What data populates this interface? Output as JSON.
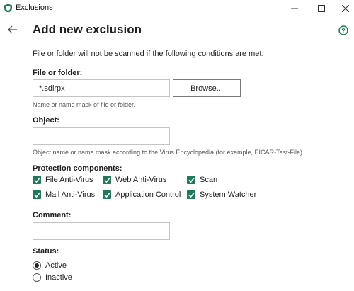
{
  "window": {
    "title": "Exclusions"
  },
  "header": {
    "title": "Add new exclusion"
  },
  "intro_text": "File or folder will not be scanned if the following conditions are met:",
  "file_or_folder": {
    "label": "File or folder:",
    "value": "*.sdlrpx",
    "browse_label": "Browse...",
    "hint": "Name or name mask of file or folder."
  },
  "object": {
    "label": "Object:",
    "value": "",
    "hint": "Object name or name mask according to the Virus Encyclopedia (for example, EICAR-Test-File)."
  },
  "protection": {
    "label": "Protection components:",
    "components": [
      {
        "label": "File Anti-Virus",
        "checked": true
      },
      {
        "label": "Web Anti-Virus",
        "checked": true
      },
      {
        "label": "Scan",
        "checked": true
      },
      {
        "label": "Mail Anti-Virus",
        "checked": true
      },
      {
        "label": "Application Control",
        "checked": true
      },
      {
        "label": "System Watcher",
        "checked": true
      }
    ]
  },
  "comment": {
    "label": "Comment:",
    "value": ""
  },
  "status": {
    "label": "Status:",
    "options": [
      {
        "label": "Active",
        "selected": true
      },
      {
        "label": "Inactive",
        "selected": false
      }
    ]
  },
  "colors": {
    "accent": "#1e7a5a",
    "title_text": "#1f1f1f"
  },
  "icons": {
    "app": "shield-icon",
    "back": "arrow-left-icon",
    "help": "help-icon",
    "minimize": "minimize-icon",
    "maximize": "maximize-icon",
    "close": "close-icon"
  }
}
